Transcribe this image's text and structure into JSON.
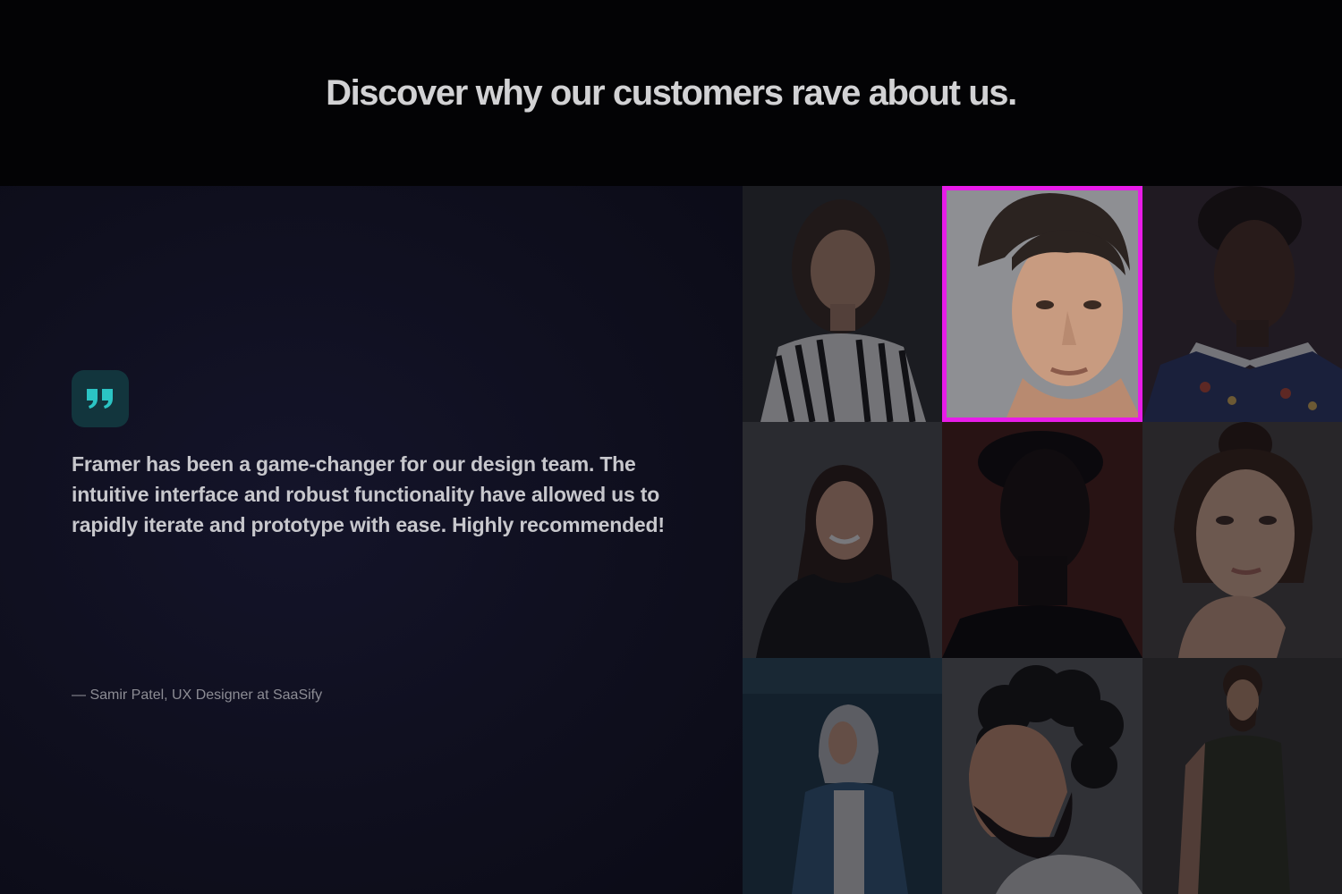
{
  "header": {
    "title": "Discover why our customers rave about us."
  },
  "testimonial": {
    "quote_icon": "quote-mark-icon",
    "quote": "Framer has been a game-changer for our design team. The intuitive interface and robust functionality have allowed us to rapidly iterate and prototype with ease. Highly recommended!",
    "attribution": "— Samir Patel, UX Designer at SaaSify"
  },
  "customer_photos": [
    {
      "subject": "woman-striped-shirt-photo",
      "selected": false
    },
    {
      "subject": "young-man-portrait-photo",
      "selected": true
    },
    {
      "subject": "woman-white-collar-photo",
      "selected": false
    },
    {
      "subject": "smiling-woman-long-hair-photo",
      "selected": false
    },
    {
      "subject": "man-red-background-photo",
      "selected": false
    },
    {
      "subject": "woman-hand-on-chin-photo",
      "selected": false
    },
    {
      "subject": "woman-denim-hoodie-photo",
      "selected": false
    },
    {
      "subject": "curly-haired-man-profile-photo",
      "selected": false
    },
    {
      "subject": "bearded-man-tshirt-photo",
      "selected": false
    }
  ],
  "colors": {
    "background": "#030305",
    "panel": "#10101f",
    "badge": "#12353d",
    "accent": "#2bc4c4",
    "selection": "#e81ce8"
  }
}
